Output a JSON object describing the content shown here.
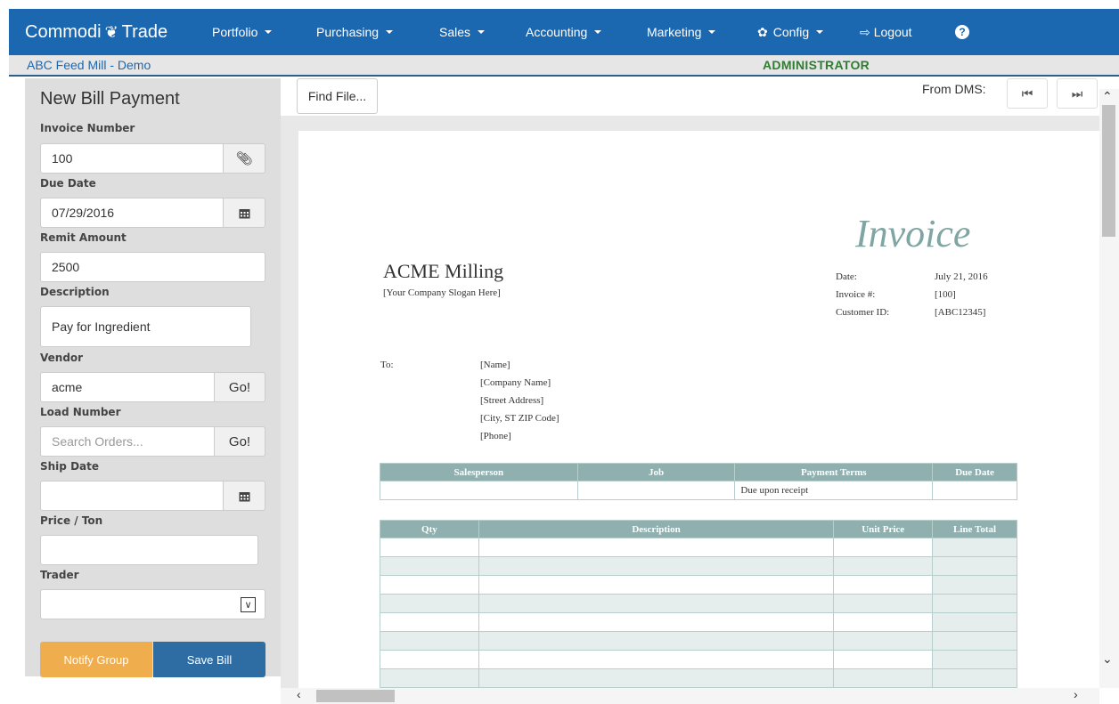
{
  "nav": {
    "brand_left": "Commodi",
    "brand_right": "Trade",
    "items": [
      "Portfolio",
      "Purchasing",
      "Sales",
      "Accounting",
      "Marketing"
    ],
    "config": "Config",
    "logout": "Logout"
  },
  "subbar": {
    "company": "ABC Feed Mill - Demo",
    "role": "ADMINISTRATOR"
  },
  "form": {
    "title": "New Bill Payment",
    "invoice_label": "Invoice Number",
    "invoice_value": "100",
    "due_label": "Due Date",
    "due_value": "07/29/2016",
    "remit_label": "Remit Amount",
    "remit_value": "2500",
    "desc_label": "Description",
    "desc_value": "Pay for Ingredient",
    "vendor_label": "Vendor",
    "vendor_value": "acme",
    "go_label": "Go!",
    "load_label": "Load Number",
    "load_placeholder": "Search Orders...",
    "ship_label": "Ship Date",
    "ship_value": "",
    "price_label": "Price / Ton",
    "price_value": "",
    "trader_label": "Trader",
    "trader_value": "",
    "notify_label": "Notify Group",
    "save_label": "Save Bill"
  },
  "viewer": {
    "find_file": "Find File...",
    "from_dms": "From DMS:"
  },
  "invoice": {
    "title": "Invoice",
    "company": "ACME Milling",
    "slogan": "[Your Company Slogan Here]",
    "date_label": "Date:",
    "date_value": "July 21, 2016",
    "invoice_label": "Invoice #:",
    "invoice_value": "[100]",
    "customer_label": "Customer ID:",
    "customer_value": "[ABC12345]",
    "to_label": "To:",
    "to_lines": [
      "[Name]",
      "[Company Name]",
      "[Street Address]",
      "[City, ST  ZIP Code]",
      "[Phone]"
    ],
    "terms_headers": [
      "Salesperson",
      "Job",
      "Payment Terms",
      "Due Date"
    ],
    "terms_values": [
      "",
      "",
      "Due upon receipt",
      ""
    ],
    "items_headers": [
      "Qty",
      "Description",
      "Unit Price",
      "Line Total"
    ]
  },
  "colors": {
    "nav_bg": "#1b67b0",
    "notify": "#f0ad4e",
    "save": "#2e6da4",
    "invoice_accent": "#8fb0ae",
    "role": "#2e7d32"
  }
}
